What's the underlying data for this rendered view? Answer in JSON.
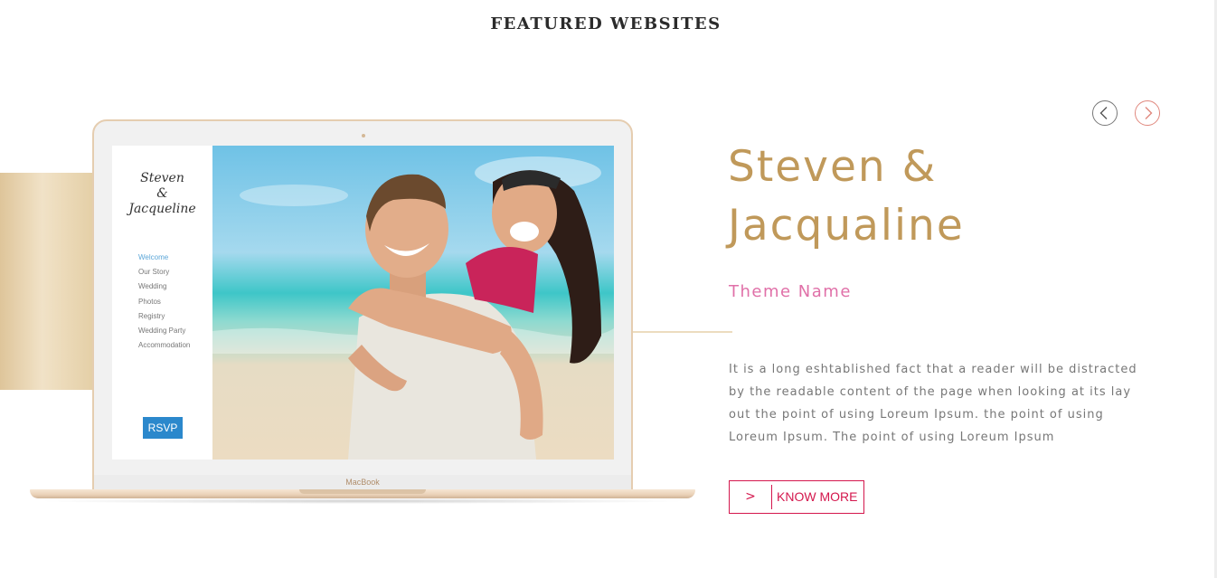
{
  "section": {
    "title": "FEATURED WEBSITES"
  },
  "preview": {
    "logo_line1": "Steven",
    "logo_line2": "&",
    "logo_line3": "Jacqueline",
    "nav_items": [
      "Welcome",
      "Our Story",
      "Wedding",
      "Photos",
      "Registry",
      "Wedding Party",
      "Accommodation"
    ],
    "active_nav": "Welcome",
    "rsvp_label": "RSVP",
    "device_label": "MacBook"
  },
  "feature": {
    "couple_name": "Steven & Jacqualine",
    "theme_name": "Theme Name",
    "description": "It is a long eshtablished fact that a reader will be distracted by the readable content of the page when looking at its lay out the point of using Loreum Ipsum. the point of using Loreum Ipsum. The point of using Loreum Ipsum",
    "button_icon": ">",
    "button_label": "KNOW MORE"
  },
  "carousel": {
    "prev_icon": "chevron-left-icon",
    "next_icon": "chevron-right-icon"
  },
  "colors": {
    "gold": "#c0995a",
    "pink": "#e070a8",
    "crimson": "#d4174d",
    "rsvp_blue": "#2b88cc",
    "text_gray": "#777777"
  }
}
